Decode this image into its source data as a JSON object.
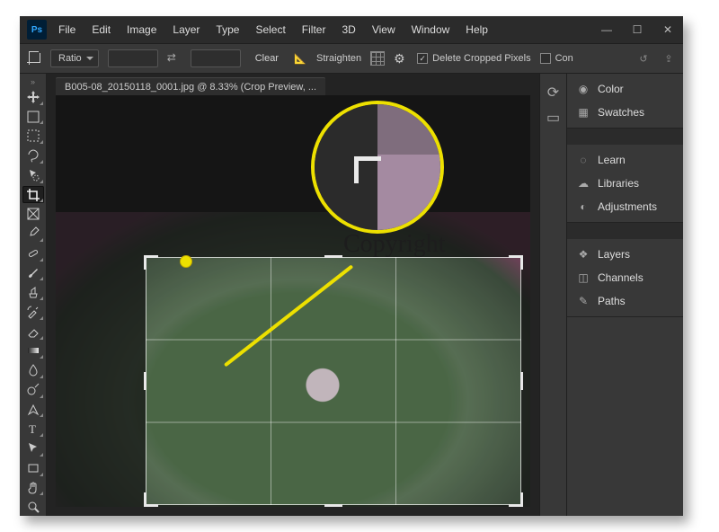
{
  "app": {
    "logo": "Ps"
  },
  "menus": [
    "File",
    "Edit",
    "Image",
    "Layer",
    "Type",
    "Select",
    "Filter",
    "3D",
    "View",
    "Window",
    "Help"
  ],
  "options": {
    "ratio_label": "Ratio",
    "clear": "Clear",
    "straighten": "Straighten",
    "delete_cropped": "Delete Cropped Pixels",
    "content_aware": "Con"
  },
  "doc": {
    "tab": "B005-08_20150118_0001.jpg @ 8.33% (Crop Preview, ..."
  },
  "watermark": "Copyright",
  "panels": {
    "color": "Color",
    "swatches": "Swatches",
    "learn": "Learn",
    "libraries": "Libraries",
    "adjustments": "Adjustments",
    "layers": "Layers",
    "channels": "Channels",
    "paths": "Paths"
  },
  "tools": [
    "move",
    "artboard",
    "marquee",
    "lasso",
    "quick-select",
    "crop",
    "frame",
    "eyedropper",
    "healing",
    "brush",
    "clone",
    "history-brush",
    "eraser",
    "gradient",
    "blur",
    "dodge",
    "pen",
    "type",
    "path-select",
    "rectangle",
    "hand",
    "zoom"
  ]
}
